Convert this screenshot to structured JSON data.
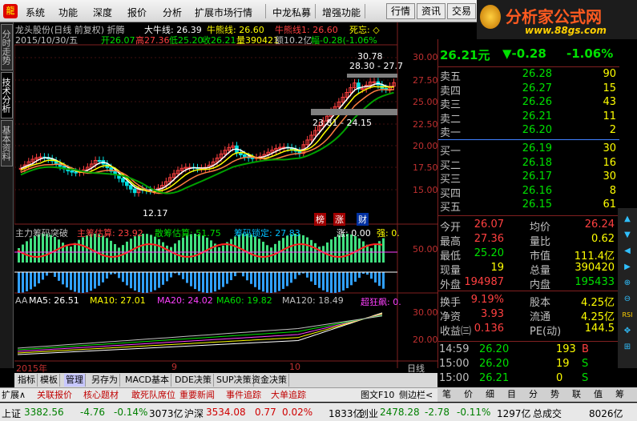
{
  "menu": {
    "items": [
      "系统",
      "功能",
      "深度",
      "报价",
      "分析",
      "扩展市场行情",
      "中龙私募",
      "增强功能"
    ],
    "buttons": [
      "行情",
      "资讯",
      "交易"
    ]
  },
  "logo": {
    "name": "分析家公式网",
    "url": "www.88gs.com"
  },
  "sidetabs": [
    "分时走势",
    "技术分析",
    "基本资料"
  ],
  "chart": {
    "title": "龙头股份(日线 前复权) 折腾",
    "ma_big_label": "大牛线: 26.39",
    "ma_bull_label": "牛熊线: 26.60",
    "bull_label": "牛熊线1: 26.60",
    "dead_label": "死忘: ◇",
    "date": "2015/10/30/五",
    "open": "开26.07",
    "high": "高27.36",
    "low": "低25.20",
    "close": "收26.21",
    "volume": "量390421",
    "amount": "额10.2亿",
    "change": "幅-0.28(-1.06%",
    "high_mark": "30.78",
    "range1": "28.30 - 27.7",
    "range2": "23.81 - 24.15",
    "low_mark": "12.17",
    "yaxis": [
      "30.00",
      "27.50",
      "25.00",
      "22.50",
      "20.00",
      "17.50",
      "15.00"
    ],
    "badges": [
      "榜",
      "涨",
      "财"
    ]
  },
  "indicator1": {
    "name": "主力筹码突破",
    "a": "主筹估算: 23.92",
    "b": "散筹估算: 51.75",
    "c": "筹码锁定: 27.83",
    "d": "涨: 0.00",
    "e": "强: 0.",
    "yaxis": "50.00"
  },
  "indicator2": {
    "name": "AA",
    "ma5": "MA5: 26.51",
    "ma10": "MA10: 27.01",
    "ma20": "MA20: 24.02",
    "ma60": "MA60: 19.82",
    "ma120": "MA120: 18.49",
    "super": "超狂飙: 0.",
    "yaxis": [
      "30.00",
      "20.00"
    ]
  },
  "xaxis": {
    "labels": [
      "2015年",
      "9",
      "10"
    ],
    "period": "日线"
  },
  "bottomtabs": [
    "指标",
    "模板",
    "管理",
    "另存为",
    "MACD基本",
    "DDE决策",
    "SUP决策",
    "资金决策"
  ],
  "funcbar": [
    "扩展∧",
    "关联报价",
    "核心题材",
    "敢死队席位",
    "重要新闻",
    "事件追踪",
    "大单追踪"
  ],
  "funcbar_right": [
    "图文F10",
    "侧边栏<"
  ],
  "quote": {
    "price": "26.21元",
    "chg": "▼-0.28",
    "pct": "-1.06%",
    "sell": [
      [
        "卖五",
        "26.28",
        "90"
      ],
      [
        "卖四",
        "26.27",
        "15"
      ],
      [
        "卖三",
        "26.26",
        "43"
      ],
      [
        "卖二",
        "26.21",
        "11"
      ],
      [
        "卖一",
        "26.20",
        "2"
      ]
    ],
    "buy": [
      [
        "买一",
        "26.19",
        "30"
      ],
      [
        "买二",
        "26.18",
        "16"
      ],
      [
        "买三",
        "26.17",
        "30"
      ],
      [
        "买四",
        "26.16",
        "8"
      ],
      [
        "买五",
        "26.15",
        "61"
      ]
    ],
    "stats": [
      [
        "今开",
        "26.07",
        "均价",
        "26.24"
      ],
      [
        "最高",
        "27.36",
        "量比",
        "0.62"
      ],
      [
        "最低",
        "25.20",
        "市值",
        "111.4亿"
      ],
      [
        "现量",
        "19",
        "总量",
        "390420"
      ],
      [
        "外盘",
        "194987",
        "内盘",
        "195433"
      ]
    ],
    "stats2": [
      [
        "换手",
        "9.19%",
        "股本",
        "4.25亿"
      ],
      [
        "净资",
        "3.93",
        "流通",
        "4.25亿"
      ],
      [
        "收益㈢",
        "0.136",
        "PE(动)",
        "144.5"
      ]
    ],
    "ticks": [
      [
        "14:59",
        "26.20",
        "193",
        "B"
      ],
      [
        "15:00",
        "26.20",
        "19",
        "S"
      ],
      [
        "15:00",
        "26.21",
        "0",
        "S"
      ]
    ]
  },
  "rtabs": [
    "笔",
    "价",
    "细",
    "目",
    "分",
    "势",
    "联",
    "值",
    "筹"
  ],
  "status": {
    "sh_name": "上证",
    "sh_val": "3382.56",
    "sh_chg": "-4.76",
    "sh_pct": "-0.14%",
    "sh_amt": "3073亿",
    "sz_name": "沪深",
    "sz_val": "3534.08",
    "sz_chg": "0.77",
    "sz_pct": "0.02%",
    "sz_amt": "1833亿",
    "cy_name": "创业",
    "cy_val": "2478.28",
    "cy_chg": "-2.78",
    "cy_pct": "-0.11%",
    "cy_amt": "1297亿",
    "total_label": "总成交",
    "total": "8026亿"
  },
  "rightbar_icons": [
    "up-icon",
    "down-icon",
    "left-icon",
    "right-icon",
    "zoom-in-icon",
    "zoom-out-icon",
    "rsi-icon"
  ],
  "colors": {
    "red": "#ff4040",
    "green": "#00e000",
    "yellow": "#ffff00",
    "cyan": "#00c0ff",
    "magenta": "#ff40ff"
  }
}
